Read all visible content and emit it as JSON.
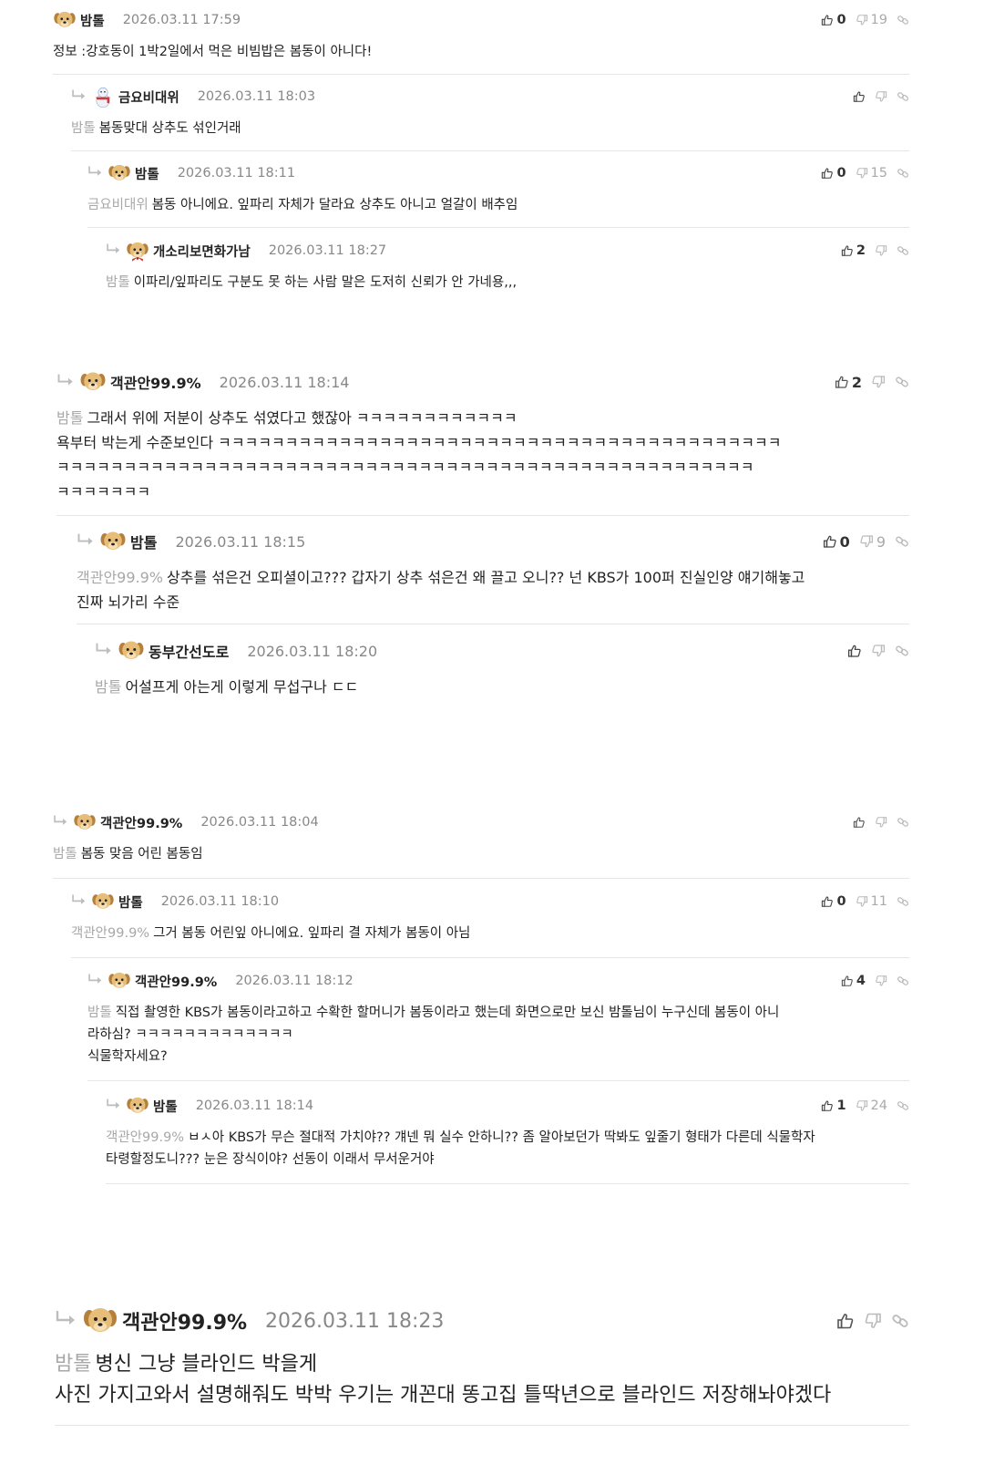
{
  "comments": [
    {
      "nick": "밤톨",
      "date": "2026.03.11 17:59",
      "up": "0",
      "down": "19",
      "mention": "",
      "lines": [
        "정보 :강호동이 1박2일에서 먹은 비빔밥은 봄동이 아니다!"
      ]
    },
    {
      "nick": "금요비대위",
      "date": "2026.03.11 18:03",
      "up": "",
      "down": "",
      "mention": "밤톨",
      "lines": [
        "봄동맞대 상추도 섞인거래"
      ]
    },
    {
      "nick": "밤톨",
      "date": "2026.03.11 18:11",
      "up": "0",
      "down": "15",
      "mention": "금요비대위",
      "lines": [
        "봄동 아니에요. 잎파리 자체가 달라요 상추도 아니고 얼갈이 배추임"
      ]
    },
    {
      "nick": "개소리보면화가남",
      "date": "2026.03.11 18:27",
      "up": "2",
      "down": "",
      "mention": "밤톨",
      "lines": [
        "이파리/잎파리도 구분도 못 하는 사람 말은 도저히 신뢰가 안 가네용,,,"
      ]
    },
    {
      "nick": "객관안99.9%",
      "date": "2026.03.11 18:14",
      "up": "2",
      "down": "",
      "mention": "밤톨",
      "lines": [
        "그래서 위에 저분이 상추도 섞였다고 했잖아 ㅋㅋㅋㅋㅋㅋㅋㅋㅋㅋㅋㅋ",
        "욕부터 박는게 수준보인다 ㅋㅋㅋㅋㅋㅋㅋㅋㅋㅋㅋㅋㅋㅋㅋㅋㅋㅋㅋㅋㅋㅋㅋㅋㅋㅋㅋㅋㅋㅋㅋㅋㅋㅋㅋㅋㅋㅋㅋㅋㅋㅋ",
        "ㅋㅋㅋㅋㅋㅋㅋㅋㅋㅋㅋㅋㅋㅋㅋㅋㅋㅋㅋㅋㅋㅋㅋㅋㅋㅋㅋㅋㅋㅋㅋㅋㅋㅋㅋㅋㅋㅋㅋㅋㅋㅋㅋㅋㅋㅋㅋㅋㅋㅋㅋㅋ",
        "ㅋㅋㅋㅋㅋㅋㅋ"
      ]
    },
    {
      "nick": "밤톨",
      "date": "2026.03.11 18:15",
      "up": "0",
      "down": "9",
      "mention": "객관안99.9%",
      "lines": [
        "상추를 섞은건 오피셜이고??? 갑자기 상추 섞은건 왜 끌고 오니?? 넌 KBS가 100퍼 진실인양 얘기해놓고",
        "진짜 뇌가리 수준"
      ]
    },
    {
      "nick": "동부간선도로",
      "date": "2026.03.11 18:20",
      "up": "",
      "down": "",
      "mention": "밤톨",
      "lines": [
        "어설프게 아는게 이렇게 무섭구나 ㄷㄷ"
      ]
    },
    {
      "nick": "객관안99.9%",
      "date": "2026.03.11 18:04",
      "up": "",
      "down": "",
      "mention": "밤톨",
      "lines": [
        "봄동 맞음 어린 봄동임"
      ]
    },
    {
      "nick": "밤톨",
      "date": "2026.03.11 18:10",
      "up": "0",
      "down": "11",
      "mention": "객관안99.9%",
      "lines": [
        "그거 봄동 어린잎 아니에요. 잎파리 결 자체가 봄동이 아님"
      ]
    },
    {
      "nick": "객관안99.9%",
      "date": "2026.03.11 18:12",
      "up": "4",
      "down": "",
      "mention": "밤톨",
      "lines": [
        "직접 촬영한 KBS가 봄동이라고하고 수확한 할머니가 봄동이라고 했는데 화면으로만 보신 밤톨님이 누구신데 봄동이 아니",
        "라하심? ㅋㅋㅋㅋㅋㅋㅋㅋㅋㅋㅋㅋㅋ",
        "식물학자세요?"
      ]
    },
    {
      "nick": "밤톨",
      "date": "2026.03.11 18:14",
      "up": "1",
      "down": "24",
      "mention": "객관안99.9%",
      "lines": [
        "ㅂㅅ아 KBS가 무슨 절대적 가치야?? 걔넨 뭐 실수 안하니?? 좀 알아보던가 딱봐도 잎줄기 형태가 다른데 식물학자",
        "타령할정도니??? 눈은 장식이야? 선동이 이래서 무서운거야"
      ]
    },
    {
      "nick": "객관안99.9%",
      "date": "2026.03.11 18:23",
      "up": "",
      "down": "",
      "mention": "밤톨",
      "lines": [
        "병신 그냥 블라인드 박을게",
        "사진 가지고와서 설명해줘도 박박 우기는 개꼰대 똥고집 틀딱년으로 블라인드 저장해놔야겠다"
      ]
    }
  ]
}
